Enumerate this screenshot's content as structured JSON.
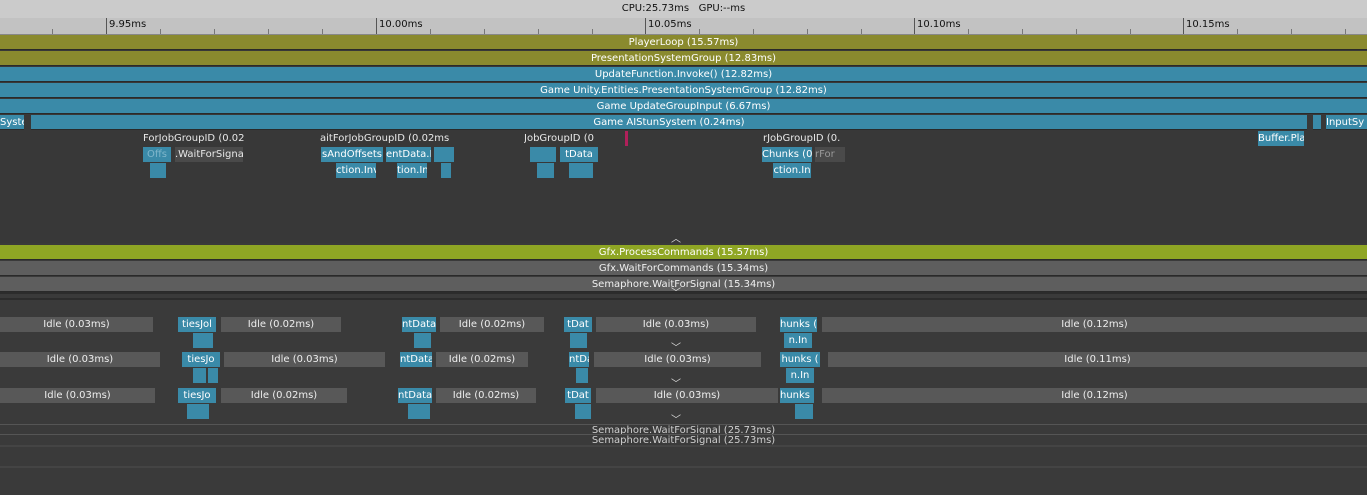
{
  "header": {
    "cpu": "CPU:25.73ms",
    "gpu": "GPU:--ms"
  },
  "ruler": {
    "labels": [
      "9.95ms",
      "10.00ms",
      "10.05ms",
      "10.10ms",
      "10.15ms"
    ]
  },
  "main_thread": {
    "player_loop": "PlayerLoop (15.57ms)",
    "presentation_group": "PresentationSystemGroup (12.83ms)",
    "update_invoke": "UpdateFunction.Invoke() (12.82ms)",
    "entities_group": "Game Unity.Entities.PresentationSystemGroup (12.82ms)",
    "update_input": "Game UpdateGroupInput (6.67ms)",
    "stun_left": "Syste",
    "stun_system": "Game AIStunSystem (0.24ms)",
    "input_right": "InputSy",
    "wait_1": "ForJobGroupID (0.02",
    "wait_2": "aitForJobGroupID (0.02ms",
    "wait_3": "JobGroupID (0",
    "wait_4": "rJobGroupID (0.",
    "job_offs": "Offs",
    "wait_signal": ".WaitForSigna",
    "sizes_offsets": "sAndOffsets",
    "ent_data": "entData.I",
    "ent_data_2": "tData",
    "chunks": "Chunks (0",
    "chunks_dim": "rFor",
    "buffer": "Buffer.Pla",
    "invoke_a": "ction.Inv",
    "invoke_b": "tion.In",
    "invoke_c": "ction.In"
  },
  "render_thread": {
    "process_commands": "Gfx.ProcessCommands (15.57ms)",
    "wait_commands": "Gfx.WaitForCommands (15.34ms)",
    "semaphore": "Semaphore.WaitForSignal (15.34ms)"
  },
  "workers": [
    {
      "idle": [
        "Idle (0.03ms)",
        "Idle (0.02ms)",
        "Idle (0.02ms)",
        "Idle (0.03ms)",
        "Idle (0.12ms)"
      ],
      "jobs": [
        "tiesJol",
        "ntData",
        "tDat",
        "hunks ("
      ],
      "sub": "n.In"
    },
    {
      "idle": [
        "Idle (0.03ms)",
        "Idle (0.03ms)",
        "Idle (0.02ms)",
        "Idle (0.03ms)",
        "Idle (0.11ms)"
      ],
      "jobs": [
        "tiesJo",
        "ntData",
        "tData",
        "hunks ("
      ],
      "sub": "n.In"
    },
    {
      "idle": [
        "Idle (0.03ms)",
        "Idle (0.02ms)",
        "Idle (0.02ms)",
        "Idle (0.03ms)",
        "Idle (0.12ms)"
      ],
      "jobs": [
        "tiesJo",
        "ntData",
        "tDat",
        "hunks ("
      ],
      "sub": ""
    }
  ],
  "bottom": {
    "semaphore_a": "Semaphore.WaitForSignal (25.73ms)",
    "semaphore_b": "Semaphore.WaitForSignal (25.73ms)"
  },
  "colors": {
    "olive": "#8a8a2e",
    "blue": "#3a8aa8",
    "lime": "#8fa624",
    "marker": "#b0205a"
  }
}
